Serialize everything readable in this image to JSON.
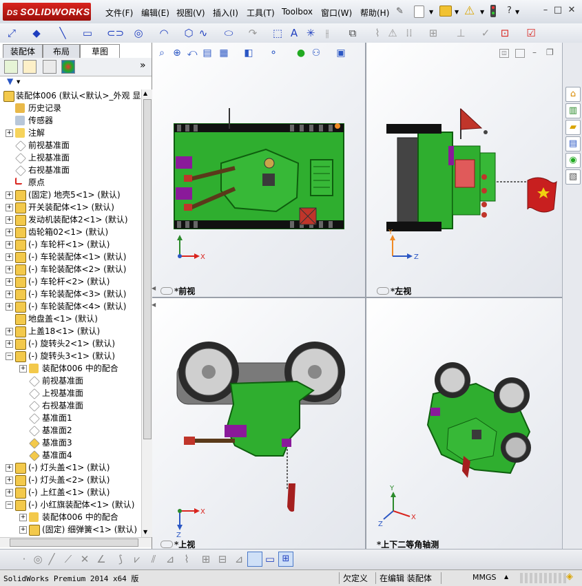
{
  "app": {
    "brand": "SOLIDWORKS",
    "ds_mark": "DS"
  },
  "menu": [
    "文件(F)",
    "编辑(E)",
    "视图(V)",
    "插入(I)",
    "工具(T)",
    "Toolbox",
    "窗口(W)",
    "帮助(H)"
  ],
  "window_controls": {
    "minimize": "–",
    "restore": "□",
    "close": "✕",
    "help": "?"
  },
  "manager_tabs": [
    "装配体",
    "布局",
    "草图"
  ],
  "active_tab": "草图",
  "tree": [
    {
      "label": "装配体006  (默认<默认>_外观 显",
      "level": 0,
      "exp": "",
      "icon": "assembly"
    },
    {
      "label": "历史记录",
      "level": 1,
      "exp": "",
      "icon": "history"
    },
    {
      "label": "传感器",
      "level": 1,
      "exp": "",
      "icon": "sensor"
    },
    {
      "label": "注解",
      "level": 1,
      "exp": "+",
      "icon": "annotation"
    },
    {
      "label": "前视基准面",
      "level": 1,
      "exp": "",
      "icon": "plane"
    },
    {
      "label": "上视基准面",
      "level": 1,
      "exp": "",
      "icon": "plane"
    },
    {
      "label": "右视基准面",
      "level": 1,
      "exp": "",
      "icon": "plane"
    },
    {
      "label": "原点",
      "level": 1,
      "exp": "",
      "icon": "origin"
    },
    {
      "label": "(固定) 地壳5<1> (默认)",
      "level": 1,
      "exp": "+",
      "icon": "part"
    },
    {
      "label": "开关装配体<1> (默认)",
      "level": 1,
      "exp": "+",
      "icon": "part"
    },
    {
      "label": "发动机装配体2<1> (默认)",
      "level": 1,
      "exp": "+",
      "icon": "part"
    },
    {
      "label": "齿轮箱02<1> (默认)",
      "level": 1,
      "exp": "+",
      "icon": "part"
    },
    {
      "label": "(-) 车轮杆<1> (默认)",
      "level": 1,
      "exp": "+",
      "icon": "part"
    },
    {
      "label": "(-) 车轮装配体<1> (默认)",
      "level": 1,
      "exp": "+",
      "icon": "part"
    },
    {
      "label": "(-) 车轮装配体<2> (默认)",
      "level": 1,
      "exp": "+",
      "icon": "part"
    },
    {
      "label": "(-) 车轮杆<2> (默认)",
      "level": 1,
      "exp": "+",
      "icon": "part"
    },
    {
      "label": "(-) 车轮装配体<3> (默认)",
      "level": 1,
      "exp": "+",
      "icon": "part"
    },
    {
      "label": "(-) 车轮装配体<4> (默认)",
      "level": 1,
      "exp": "+",
      "icon": "part"
    },
    {
      "label": "地盘盖<1> (默认)",
      "level": 1,
      "exp": "",
      "icon": "part"
    },
    {
      "label": "上盖18<1> (默认)",
      "level": 1,
      "exp": "+",
      "icon": "part"
    },
    {
      "label": "(-) 旋转头2<1> (默认)",
      "level": 1,
      "exp": "+",
      "icon": "part"
    },
    {
      "label": "(-) 旋转头3<1> (默认)",
      "level": 1,
      "exp": "−",
      "icon": "part"
    },
    {
      "label": "装配体006 中的配合",
      "level": 2,
      "exp": "+",
      "icon": "mate"
    },
    {
      "label": "前视基准面",
      "level": 2,
      "exp": "",
      "icon": "plane"
    },
    {
      "label": "上视基准面",
      "level": 2,
      "exp": "",
      "icon": "plane"
    },
    {
      "label": "右视基准面",
      "level": 2,
      "exp": "",
      "icon": "plane"
    },
    {
      "label": "基准面1",
      "level": 2,
      "exp": "",
      "icon": "plane"
    },
    {
      "label": "基准面2",
      "level": 2,
      "exp": "",
      "icon": "plane"
    },
    {
      "label": "基准面3",
      "level": 2,
      "exp": "",
      "icon": "plane-y"
    },
    {
      "label": "基准面4",
      "level": 2,
      "exp": "",
      "icon": "plane-y"
    },
    {
      "label": "(-) 灯头盖<1> (默认)",
      "level": 1,
      "exp": "+",
      "icon": "part"
    },
    {
      "label": "(-) 灯头盖<2> (默认)",
      "level": 1,
      "exp": "+",
      "icon": "part"
    },
    {
      "label": "(-) 上红盖<1> (默认)",
      "level": 1,
      "exp": "+",
      "icon": "part"
    },
    {
      "label": "(-) 小红旗装配体<1> (默认)",
      "level": 1,
      "exp": "−",
      "icon": "part"
    },
    {
      "label": "装配体006 中的配合",
      "level": 2,
      "exp": "+",
      "icon": "mate"
    },
    {
      "label": "(固定) 细弹簧<1> (默认)",
      "level": 2,
      "exp": "+",
      "icon": "part"
    }
  ],
  "views": {
    "front": "*前视",
    "left": "*左视",
    "top": "*上视",
    "iso": "*上下二等角轴测"
  },
  "axes": {
    "x": "X",
    "y": "Y",
    "z": "Z"
  },
  "status": {
    "product": "SolidWorks Premium 2014 x64 版",
    "undefined": "欠定义",
    "editing": "在编辑 装配体",
    "units": "MMGS",
    "units_arrow": "▲"
  },
  "colors": {
    "model_green": "#2fae2f",
    "model_dark": "#0e5e0e",
    "barrel_red": "#c0352a",
    "wheel_gray": "#8a8a8a",
    "accent_red": "#d9241e",
    "sw_blue": "#1f3fbf"
  }
}
